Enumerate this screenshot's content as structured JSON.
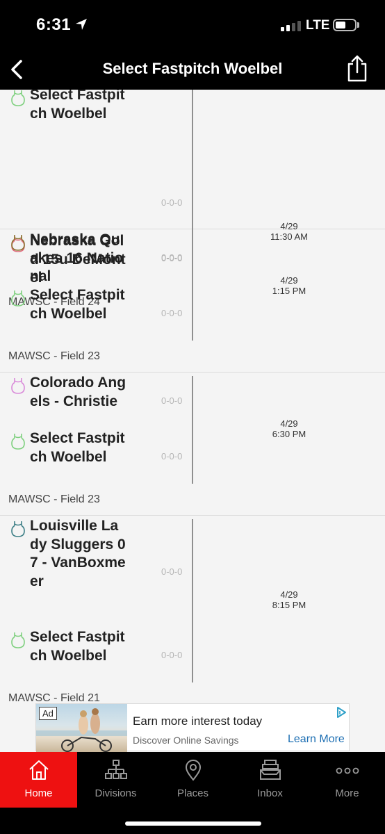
{
  "status": {
    "time": "6:31",
    "network": "LTE"
  },
  "nav": {
    "title": "Select Fastpitch Woelbel"
  },
  "colors": {
    "accent": "#ee1111",
    "select": "#7fd07f",
    "nebraska_gold": "#e06b7d",
    "quakes": "#8b7330",
    "colorado": "#d98ad9",
    "louisville": "#3d7f86"
  },
  "games": [
    {
      "home": {
        "name": "Select Fastpitch Woelbel",
        "record": "0-0-0"
      },
      "away": {
        "name": "Nebraska Gold 15u DeMontel",
        "record": "0-0-0"
      },
      "date": "4/29",
      "time": "11:30 AM",
      "venue": "MAWSC - Field 24"
    },
    {
      "home": {
        "name": "Nebraska Quakes 16 National",
        "record": "0-0-0"
      },
      "away": {
        "name": "Select Fastpitch Woelbel",
        "record": "0-0-0"
      },
      "date": "4/29",
      "time": "1:15 PM",
      "venue": "MAWSC - Field 23"
    },
    {
      "home": {
        "name": "Colorado Angels - Christie",
        "record": "0-0-0"
      },
      "away": {
        "name": "Select Fastpitch Woelbel",
        "record": "0-0-0"
      },
      "date": "4/29",
      "time": "6:30 PM",
      "venue": "MAWSC - Field 23"
    },
    {
      "home": {
        "name": "Louisville Lady Sluggers 07 - VanBoxmeer",
        "record": "0-0-0"
      },
      "away": {
        "name": "Select Fastpitch Woelbel",
        "record": "0-0-0"
      },
      "date": "4/29",
      "time": "8:15 PM",
      "venue": "MAWSC - Field 21"
    }
  ],
  "ad": {
    "badge": "Ad",
    "title": "Earn more interest today",
    "subtitle": "Discover Online Savings",
    "cta": "Learn More"
  },
  "tabs": [
    {
      "label": "Home",
      "icon": "home-icon",
      "active": true
    },
    {
      "label": "Divisions",
      "icon": "divisions-icon"
    },
    {
      "label": "Places",
      "icon": "location-pin-icon"
    },
    {
      "label": "Inbox",
      "icon": "inbox-icon"
    },
    {
      "label": "More",
      "icon": "more-icon"
    }
  ]
}
